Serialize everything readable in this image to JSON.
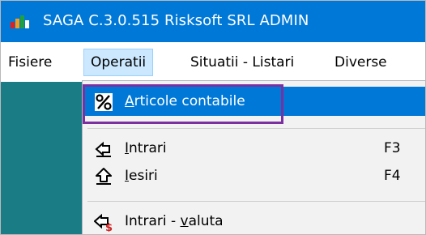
{
  "window": {
    "title": "SAGA C.3.0.515  Risksoft SRL  ADMIN",
    "icon": "saga-app-icon"
  },
  "menubar": {
    "items": [
      {
        "label": "Fisiere"
      },
      {
        "label": "Operatii",
        "active": true
      },
      {
        "label": "Situatii - Listari"
      },
      {
        "label": "Diverse"
      }
    ]
  },
  "dropdown": {
    "items": [
      {
        "key": "articole",
        "mnemonic": "A",
        "rest": "rticole contabile",
        "icon": "percent-icon",
        "selected": true
      },
      {
        "key": "intrari",
        "mnemonic": "I",
        "rest": "ntrari",
        "shortcut": "F3",
        "icon": "inbox-arrow-icon"
      },
      {
        "key": "iesiri",
        "mnemonic": "I",
        "rest": "esiri",
        "shortcut": "F4",
        "icon": "outbox-arrow-icon"
      },
      {
        "key": "intrari_valuta",
        "prefix": "Intrari - ",
        "mnemonic": "v",
        "rest": "aluta",
        "icon": "inbox-currency-icon"
      }
    ]
  },
  "colors": {
    "titlebar": "#0078d7",
    "selection": "#0078d7",
    "workspace": "#1a7c85",
    "highlight_box": "#7b2fa0",
    "menu_active_bg": "#cce8ff"
  }
}
